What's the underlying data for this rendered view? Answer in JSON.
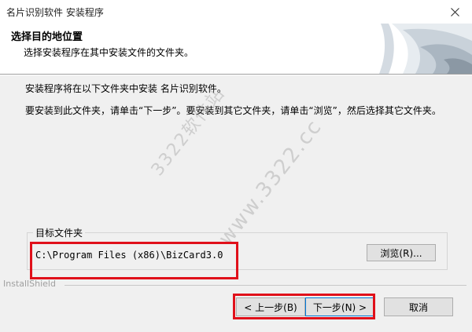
{
  "window": {
    "title": "名片识别软件 安装程序"
  },
  "header": {
    "title": "选择目的地位置",
    "subtitle": "选择安装程序在其中安装文件的文件夹。"
  },
  "body": {
    "line1": "安装程序将在以下文件夹中安装 名片识别软件。",
    "line2": "要安装到此文件夹，请单击“下一步”。要安装到其它文件夹，请单击“浏览”，然后选择其它文件夹。"
  },
  "watermark": {
    "text1": "3322软件站",
    "text2": "www.3322.cc"
  },
  "destination": {
    "group_label": "目标文件夹",
    "path": "C:\\Program Files (x86)\\BizCard3.0",
    "browse_label": "浏览(R)..."
  },
  "footer": {
    "brand": "InstallShield",
    "back_label": "< 上一步(B)",
    "next_label": "下一步(N) >",
    "cancel_label": "取消"
  },
  "colors": {
    "highlight": "#e0101a",
    "default_button_border": "#0078d7"
  }
}
